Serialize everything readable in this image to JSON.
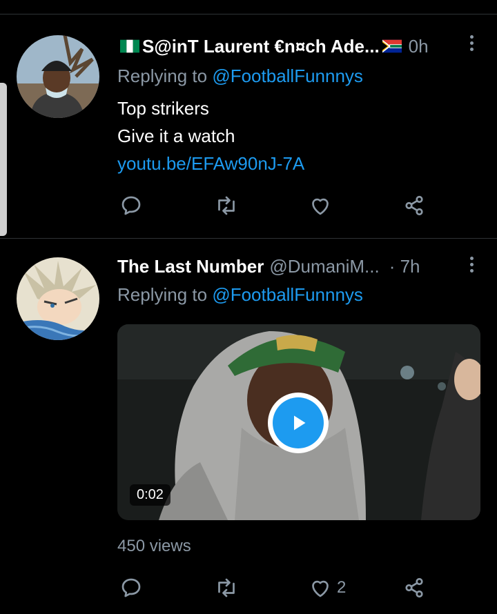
{
  "colors": {
    "background": "#000000",
    "accent": "#1d9bf0",
    "muted": "#8b98a5",
    "divider": "#2f3336"
  },
  "tweets": [
    {
      "author_name": "S@inT Laurent €n¤ch Ade...",
      "author_flags": [
        "nigeria-flag-icon",
        "south-africa-flag-icon"
      ],
      "time": "0h",
      "reply_prefix": "Replying to",
      "reply_to": "@FootballFunnnys",
      "text_lines": [
        "Top strikers",
        "Give it a watch"
      ],
      "link": "youtu.be/EFAw90nJ-7A",
      "actions": {
        "reply": "",
        "retweet": "",
        "like": "",
        "share": ""
      }
    },
    {
      "author_name": "The Last Number",
      "author_handle": "@DumaniM...",
      "time": "· 7h",
      "reply_prefix": "Replying to",
      "reply_to": "@FootballFunnnys",
      "video": {
        "duration": "0:02",
        "views": "450 views"
      },
      "actions": {
        "reply": "",
        "retweet": "",
        "like": "2",
        "share": ""
      }
    }
  ]
}
